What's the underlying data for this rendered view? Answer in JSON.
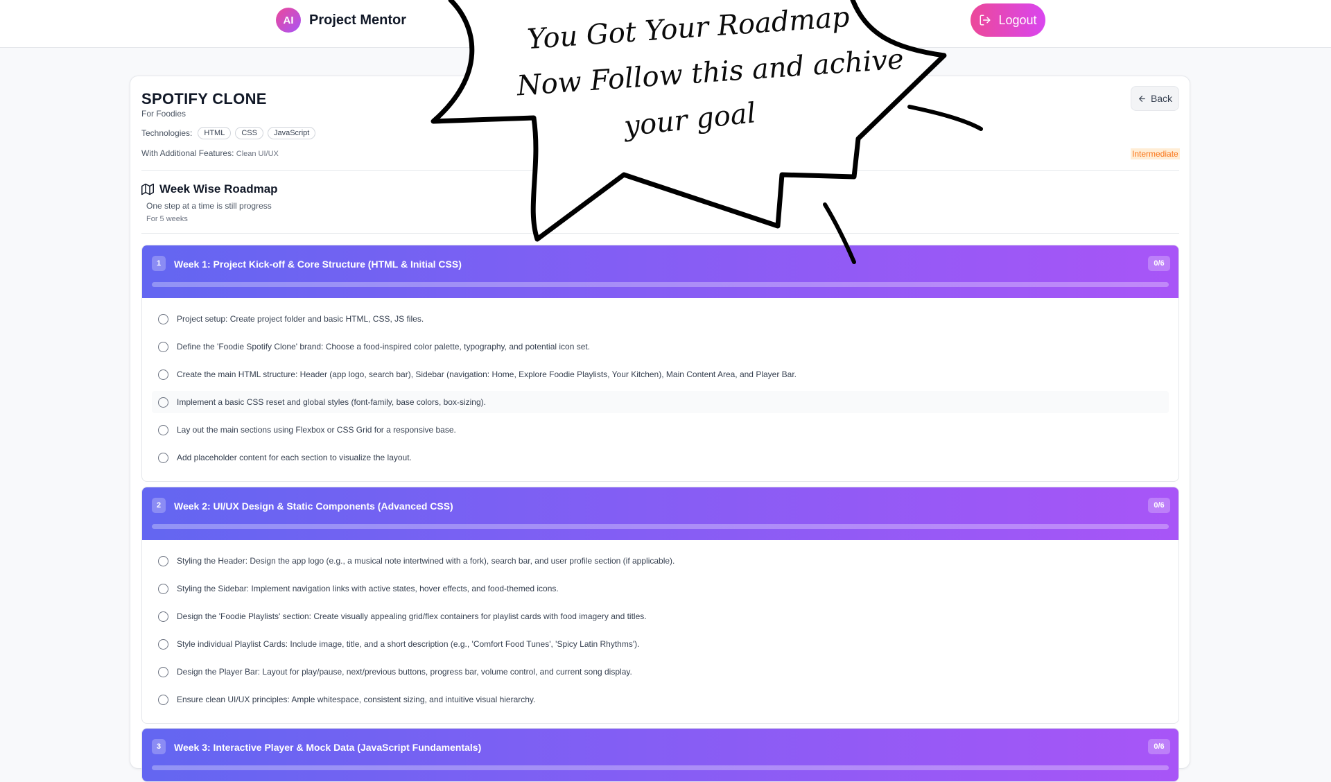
{
  "app": {
    "logo_text": "AI",
    "name": "Project Mentor",
    "logout_label": "Logout"
  },
  "project": {
    "title": "SPOTIFY CLONE",
    "subtitle": "For Foodies",
    "technologies_label": "Technologies:",
    "technologies": [
      "HTML",
      "CSS",
      "JavaScript"
    ],
    "features_label": "With Additional Features:",
    "features_value": "Clean UI/UX",
    "back_label": "Back",
    "level": "Intermediate"
  },
  "roadmap": {
    "title": "Week Wise Roadmap",
    "subtitle": "One step at a time is still progress",
    "duration": "For 5 weeks"
  },
  "weeks": [
    {
      "number": "1",
      "title": "Week 1: Project Kick-off & Core Structure (HTML & Initial CSS)",
      "count": "0/6",
      "progress": 0,
      "tasks": [
        "Project setup: Create project folder and basic HTML, CSS, JS files.",
        "Define the 'Foodie Spotify Clone' brand: Choose a food-inspired color palette, typography, and potential icon set.",
        "Create the main HTML structure: Header (app logo, search bar), Sidebar (navigation: Home, Explore Foodie Playlists, Your Kitchen), Main Content Area, and Player Bar.",
        "Implement a basic CSS reset and global styles (font-family, base colors, box-sizing).",
        "Lay out the main sections using Flexbox or CSS Grid for a responsive base.",
        "Add placeholder content for each section to visualize the layout."
      ]
    },
    {
      "number": "2",
      "title": "Week 2: UI/UX Design & Static Components (Advanced CSS)",
      "count": "0/6",
      "progress": 0,
      "tasks": [
        "Styling the Header: Design the app logo (e.g., a musical note intertwined with a fork), search bar, and user profile section (if applicable).",
        "Styling the Sidebar: Implement navigation links with active states, hover effects, and food-themed icons.",
        "Design the 'Foodie Playlists' section: Create visually appealing grid/flex containers for playlist cards with food imagery and titles.",
        "Style individual Playlist Cards: Include image, title, and a short description (e.g., 'Comfort Food Tunes', 'Spicy Latin Rhythms').",
        "Design the Player Bar: Layout for play/pause, next/previous buttons, progress bar, volume control, and current song display.",
        "Ensure clean UI/UX principles: Ample whitespace, consistent sizing, and intuitive visual hierarchy."
      ]
    },
    {
      "number": "3",
      "title": "Week 3: Interactive Player & Mock Data (JavaScript Fundamentals)",
      "count": "0/6",
      "progress": 0,
      "tasks": []
    }
  ],
  "overlay": {
    "lines": [
      "You Got Your Roadmap",
      "Now Follow this and achive",
      "your goal"
    ]
  }
}
